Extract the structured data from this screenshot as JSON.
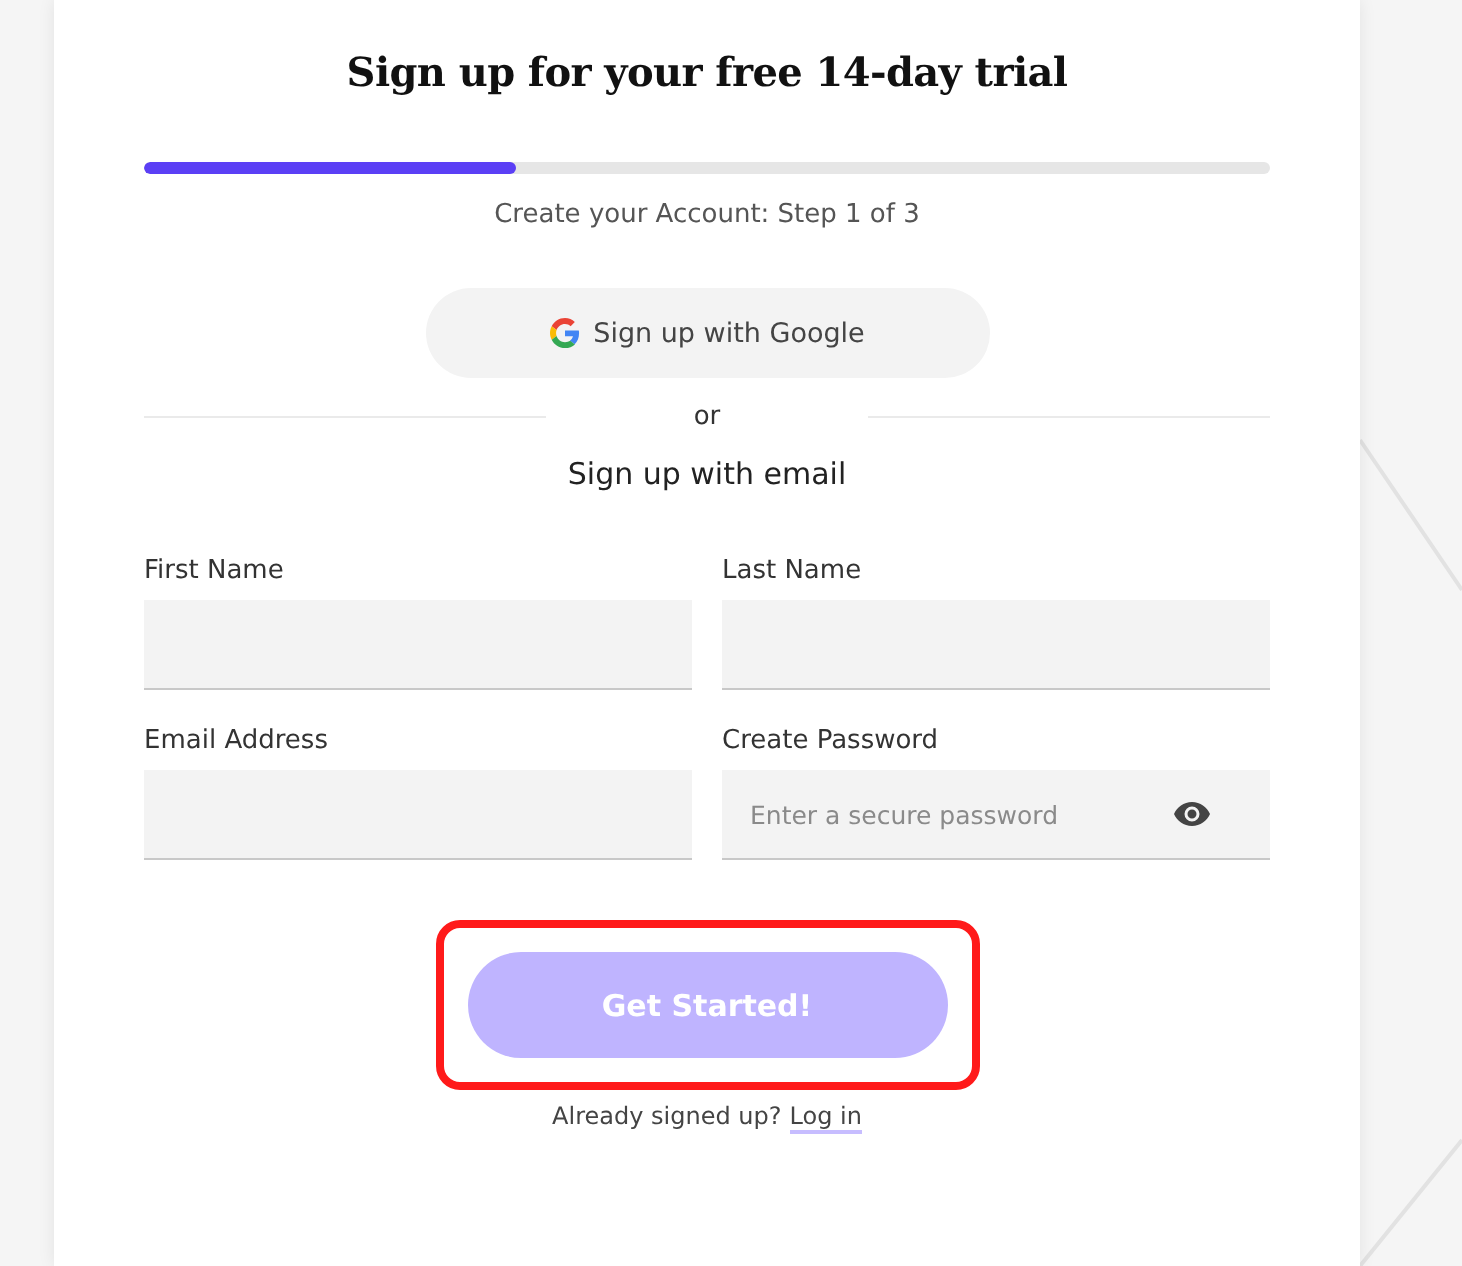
{
  "title": "Sign up for your free 14-day trial",
  "progress": {
    "level": 0.33,
    "caption": "Create your Account: Step 1 of 3"
  },
  "google_button": {
    "label": "Sign up with Google"
  },
  "divider": {
    "label": "or"
  },
  "email_heading": "Sign up with email",
  "fields": [
    {
      "kind": "text",
      "label": "First Name"
    },
    {
      "kind": "text",
      "label": "Last Name"
    },
    {
      "kind": "text",
      "label": "Email Address"
    },
    {
      "kind": "password",
      "label": "Create Password",
      "placeholder": "Enter a secure password"
    }
  ],
  "submit": {
    "label": "Get Started!",
    "disabled": true,
    "highlighted": true
  },
  "footer": {
    "text": "Already signed up?",
    "link": "Log in"
  }
}
